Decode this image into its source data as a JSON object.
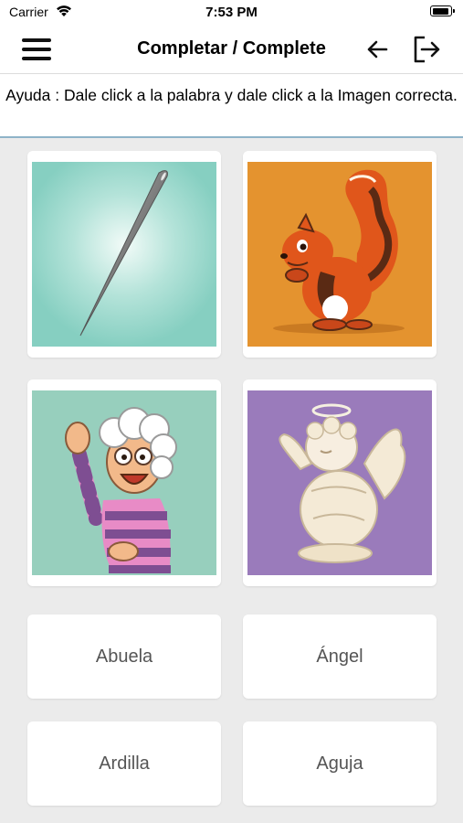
{
  "status_bar": {
    "carrier": "Carrier",
    "time": "7:53 PM"
  },
  "nav": {
    "title": "Completar / Complete",
    "menu_icon": "hamburger-menu-icon",
    "back_icon": "arrow-left-icon",
    "exit_icon": "logout-icon"
  },
  "help": {
    "text": "Ayuda : Dale click a la palabra y dale click a la Imagen correcta."
  },
  "images": [
    {
      "subject": "needle",
      "background": "#86cfc1"
    },
    {
      "subject": "squirrel",
      "background": "#e4932f"
    },
    {
      "subject": "grandmother",
      "background": "#97cfbd"
    },
    {
      "subject": "angel",
      "background": "#9a7bbb"
    }
  ],
  "words": [
    "Abuela",
    "Ángel",
    "Ardilla",
    "Aguja"
  ],
  "colors": {
    "background": "#ebebeb",
    "help_border": "#8fb3c8",
    "word_text": "#555555"
  }
}
